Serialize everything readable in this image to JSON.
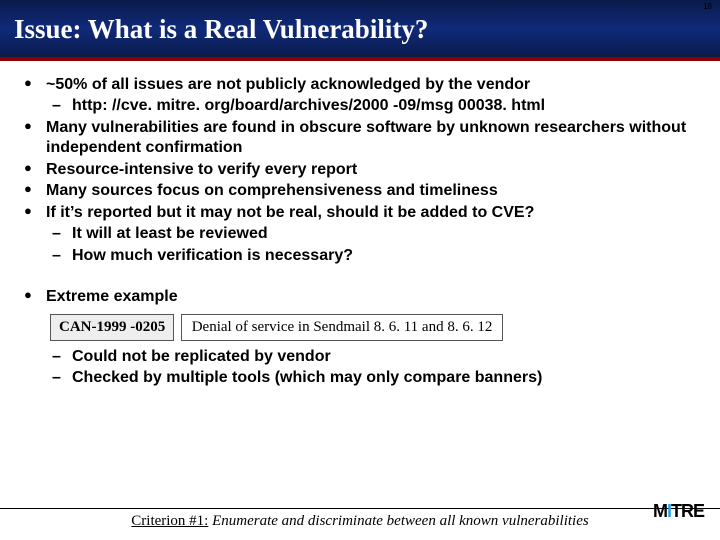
{
  "page_number": "18",
  "title": "Issue: What is a Real Vulnerability?",
  "bullets": {
    "b1": "~50% of all issues are not publicly acknowledged by the vendor",
    "b1s1": "http: //cve. mitre. org/board/archives/2000 -09/msg 00038. html",
    "b2": "Many vulnerabilities are found in obscure software by unknown researchers without independent confirmation",
    "b3": "Resource-intensive to verify every report",
    "b4": "Many sources focus on comprehensiveness and timeliness",
    "b5": "If it’s reported but it may not be real, should it be added to CVE?",
    "b5s1": "It will at least be reviewed",
    "b5s2": "How much verification is necessary?",
    "b6": "Extreme example",
    "b6s1": "Could not be replicated by vendor",
    "b6s2": "Checked by multiple tools (which may only compare banners)"
  },
  "example": {
    "id": "CAN-1999 -0205",
    "desc": "Denial of service in Sendmail 8. 6. 11 and 8. 6. 12"
  },
  "footer": {
    "label": "Criterion #1:",
    "text": " Enumerate and discriminate between all known vulnerabilities"
  },
  "logo": {
    "m1": "M",
    "i": "I",
    "rest": "TRE"
  }
}
